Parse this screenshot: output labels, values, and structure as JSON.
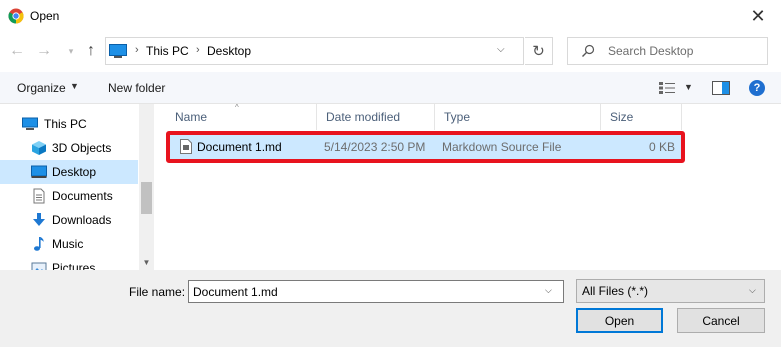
{
  "window": {
    "title": "Open",
    "close_glyph": "✕",
    "app_icon": "chrome-icon"
  },
  "nav": {
    "back_glyph": "←",
    "forward_glyph": "→",
    "recent_glyph": "▾",
    "up_glyph": "↑"
  },
  "address": {
    "crumbs": [
      "This PC",
      "Desktop"
    ],
    "separator": "›",
    "dropdown_glyph": "⌵",
    "refresh_glyph": "↻"
  },
  "search": {
    "placeholder": "Search Desktop"
  },
  "toolbar": {
    "organize_label": "Organize",
    "organize_caret": "▼",
    "new_folder_label": "New folder",
    "view_caret": "▼",
    "help_label": "?"
  },
  "sidebar": {
    "items": [
      {
        "label": "This PC",
        "icon": "pc-icon"
      },
      {
        "label": "3D Objects",
        "icon": "cube-icon"
      },
      {
        "label": "Desktop",
        "icon": "desktop-icon",
        "selected": true
      },
      {
        "label": "Documents",
        "icon": "documents-icon"
      },
      {
        "label": "Downloads",
        "icon": "download-icon"
      },
      {
        "label": "Music",
        "icon": "music-icon"
      },
      {
        "label": "Pictures",
        "icon": "pictures-icon"
      }
    ],
    "scroll_down_glyph": "▼"
  },
  "file_list": {
    "columns": [
      "Name",
      "Date modified",
      "Type",
      "Size"
    ],
    "sort_glyph": "^",
    "rows": [
      {
        "name": "Document 1.md",
        "date": "5/14/2023 2:50 PM",
        "type": "Markdown Source File",
        "size": "0 KB",
        "selected": true
      }
    ]
  },
  "bottom": {
    "filename_label": "File name:",
    "filename_value": "Document 1.md",
    "filename_dropdown_glyph": "⌵",
    "filetype_value": "All Files (*.*)",
    "filetype_dropdown_glyph": "⌵",
    "open_label": "Open",
    "cancel_label": "Cancel"
  },
  "colors": {
    "selection": "#cce8ff",
    "highlight_outline": "#e8131e",
    "accent": "#0078d7"
  }
}
